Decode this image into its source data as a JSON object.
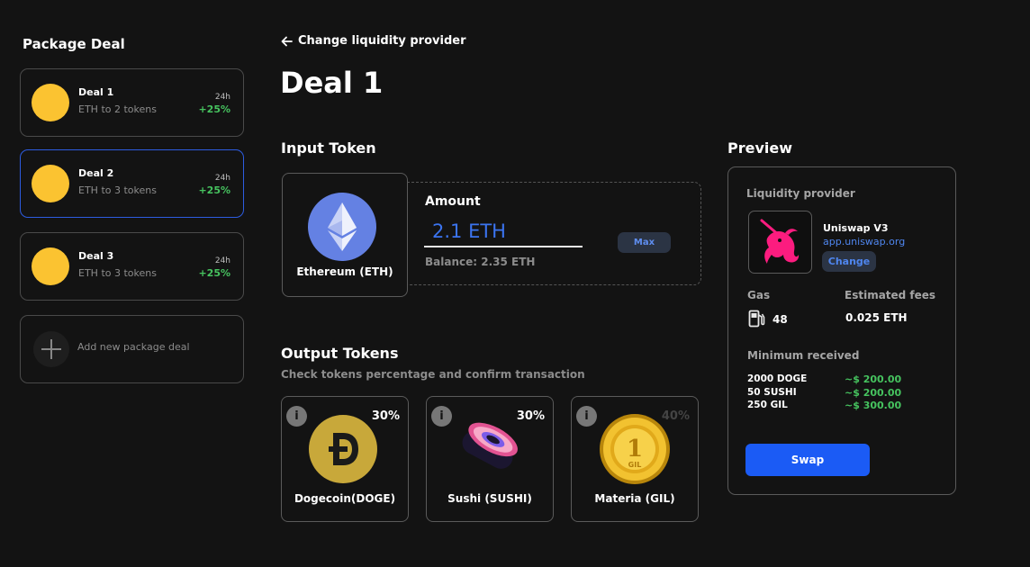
{
  "sidebar": {
    "title": "Package Deal",
    "deals": [
      {
        "name": "Deal 1",
        "subtitle": "ETH to 2 tokens",
        "period": "24h",
        "change": "+25%"
      },
      {
        "name": "Deal 2",
        "subtitle": "ETH to 3 tokens",
        "period": "24h",
        "change": "+25%"
      },
      {
        "name": "Deal 3",
        "subtitle": "ETH to 3 tokens",
        "period": "24h",
        "change": "+25%"
      }
    ],
    "add_label": "Add new package deal"
  },
  "header": {
    "back_label": "Change liquidity provider",
    "title": "Deal 1"
  },
  "input": {
    "section_title": "Input Token",
    "token_name": "Ethereum (ETH)",
    "amount_label": "Amount",
    "amount_value": "2.1 ETH",
    "balance": "Balance: 2.35 ETH",
    "max_label": "Max"
  },
  "output": {
    "section_title": "Output Tokens",
    "subtitle": "Check tokens percentage and confirm transaction",
    "tokens": [
      {
        "name": "Dogecoin(DOGE)",
        "percent": "30%",
        "icon": "dogecoin-icon"
      },
      {
        "name": "Sushi (SUSHI)",
        "percent": "30%",
        "icon": "sushi-icon"
      },
      {
        "name": "Materia (GIL)",
        "percent": "40%",
        "icon": "gil-coin-icon"
      }
    ],
    "info_glyph": "i"
  },
  "preview": {
    "section_title": "Preview",
    "provider_label": "Liquidity provider",
    "provider_name": "Uniswap V3",
    "provider_url": "app.uniswap.org",
    "change_label": "Change",
    "gas_label": "Gas",
    "gas_value": "48",
    "fees_label": "Estimated fees",
    "fees_value": "0.025 ETH",
    "min_label": "Minimum received",
    "min_received": [
      {
        "amount": "2000 DOGE",
        "value": "~$ 200.00"
      },
      {
        "amount": "50 SUSHI",
        "value": "~$ 200.00"
      },
      {
        "amount": "250 GIL",
        "value": "~$ 300.00"
      }
    ],
    "swap_label": "Swap"
  },
  "colors": {
    "background": "#131313",
    "accent": "#1b5bf5",
    "positive": "#46c35f",
    "coin": "#fbc331"
  }
}
